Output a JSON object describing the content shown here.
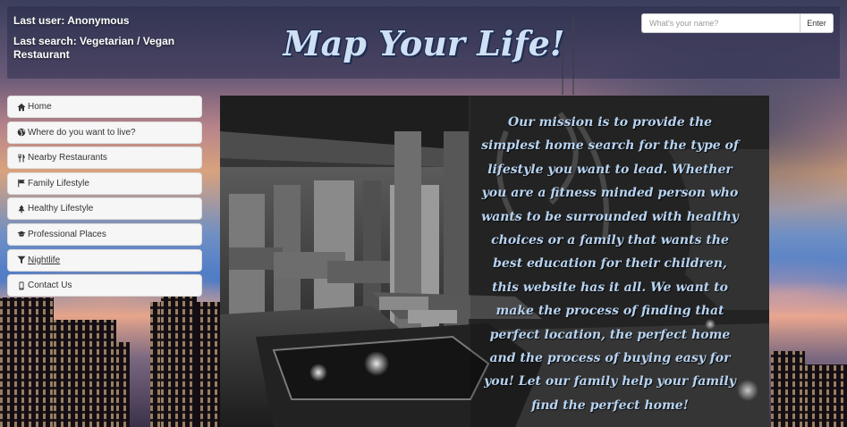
{
  "header": {
    "last_user": "Last user: Anonymous",
    "last_search": "Last search: Vegetarian / Vegan Restaurant",
    "title": "Map Your Life!",
    "name_input_placeholder": "What's your name?",
    "enter_label": "Enter"
  },
  "nav": {
    "items": [
      {
        "label": "Home",
        "icon": "home-icon"
      },
      {
        "label": "Where do you want to live?",
        "icon": "globe-icon"
      },
      {
        "label": "Nearby Restaurants",
        "icon": "cutlery-icon"
      },
      {
        "label": "Family Lifestyle",
        "icon": "flag-icon"
      },
      {
        "label": "Healthy Lifestyle",
        "icon": "tree-icon"
      },
      {
        "label": "Professional Places",
        "icon": "graduation-cap-icon"
      },
      {
        "label": "Nightlife",
        "icon": "filter-icon",
        "active": true
      },
      {
        "label": "Contact Us",
        "icon": "phone-icon"
      }
    ]
  },
  "main": {
    "mission": "Our mission is to provide the simplest home search for the type of lifestyle you want to lead. Whether you are a fitness minded person who wants to be surrounded with healthy choices or a family that wants the best education for their children, this website has it all. We want to make the process of finding that perfect location, the perfect home and the process of buying easy for you! Let our family help your family find the perfect home!"
  },
  "colors": {
    "title_text": "#cfe0f5",
    "mission_text": "#b7d3f2",
    "nav_background": "#f6f6f6"
  }
}
